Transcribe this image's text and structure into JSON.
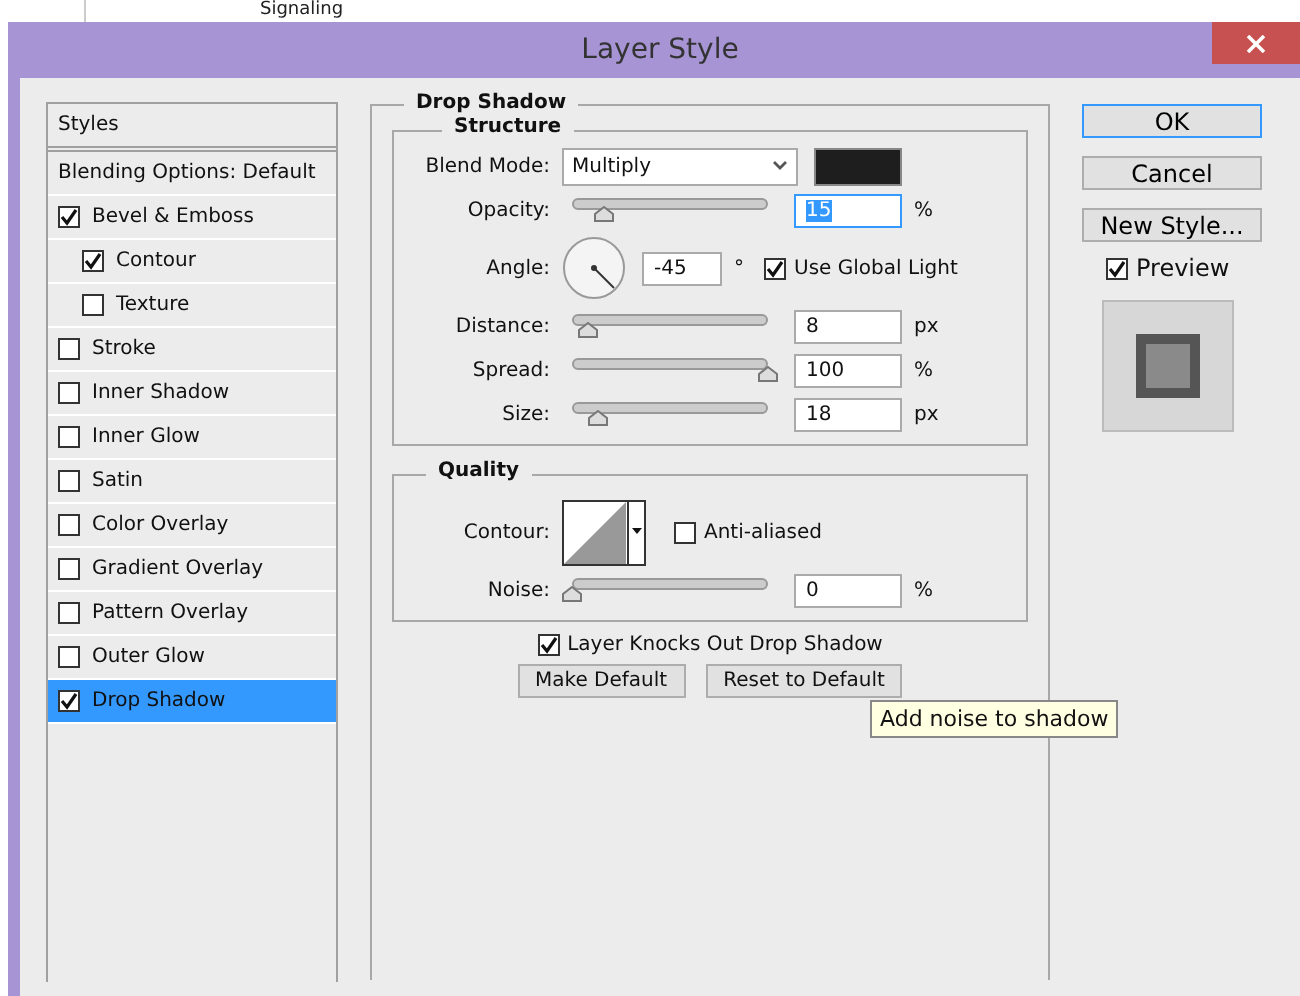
{
  "background": {
    "text": "Signaling"
  },
  "window": {
    "title": "Layer Style"
  },
  "styles_panel": {
    "header": "Styles",
    "items": [
      {
        "kind": "plain",
        "label": "Blending Options: Default",
        "selected": false
      },
      {
        "kind": "check",
        "label": "Bevel & Emboss",
        "checked": true,
        "selected": false,
        "children": [
          {
            "kind": "check",
            "label": "Contour",
            "checked": true,
            "selected": false
          },
          {
            "kind": "check",
            "label": "Texture",
            "checked": false,
            "selected": false
          }
        ]
      },
      {
        "kind": "check",
        "label": "Stroke",
        "checked": false,
        "selected": false
      },
      {
        "kind": "check",
        "label": "Inner Shadow",
        "checked": false,
        "selected": false
      },
      {
        "kind": "check",
        "label": "Inner Glow",
        "checked": false,
        "selected": false
      },
      {
        "kind": "check",
        "label": "Satin",
        "checked": false,
        "selected": false
      },
      {
        "kind": "check",
        "label": "Color Overlay",
        "checked": false,
        "selected": false
      },
      {
        "kind": "check",
        "label": "Gradient Overlay",
        "checked": false,
        "selected": false
      },
      {
        "kind": "check",
        "label": "Pattern Overlay",
        "checked": false,
        "selected": false
      },
      {
        "kind": "check",
        "label": "Outer Glow",
        "checked": false,
        "selected": false
      },
      {
        "kind": "check",
        "label": "Drop Shadow",
        "checked": true,
        "selected": true
      }
    ]
  },
  "drop_shadow": {
    "title": "Drop Shadow",
    "structure": {
      "title": "Structure",
      "blend_mode": {
        "label": "Blend Mode:",
        "value": "Multiply"
      },
      "rows": [
        {
          "kind": "slider",
          "label": "Opacity:",
          "level": 0.16,
          "value": "15",
          "unit": "%",
          "selected": true
        },
        {
          "kind": "angle",
          "label": "Angle:",
          "value": "-45",
          "unit": "°",
          "global_light": {
            "label": "Use Global Light",
            "checked": true
          }
        },
        {
          "kind": "slider",
          "label": "Distance:",
          "level": 0.08,
          "value": "8",
          "unit": "px",
          "selected": false
        },
        {
          "kind": "slider",
          "label": "Spread:",
          "level": 1.0,
          "value": "100",
          "unit": "%",
          "selected": false
        },
        {
          "kind": "slider",
          "label": "Size:",
          "level": 0.13,
          "value": "18",
          "unit": "px",
          "selected": false
        }
      ]
    },
    "quality": {
      "title": "Quality",
      "contour_label": "Contour:",
      "anti_aliased": {
        "label": "Anti-aliased",
        "checked": false
      },
      "noise": {
        "label": "Noise:",
        "level": 0,
        "value": "0",
        "unit": "%"
      }
    },
    "knockout": {
      "label": "Layer Knocks Out Drop Shadow",
      "checked": true
    },
    "buttons": [
      "Make Default",
      "Reset to Default"
    ]
  },
  "actions": [
    {
      "label": "OK",
      "default": true
    },
    {
      "label": "Cancel",
      "default": false
    },
    {
      "label": "New Style...",
      "default": false
    }
  ],
  "preview": {
    "label": "Preview",
    "checked": true
  },
  "tooltip": "Add noise to shadow"
}
